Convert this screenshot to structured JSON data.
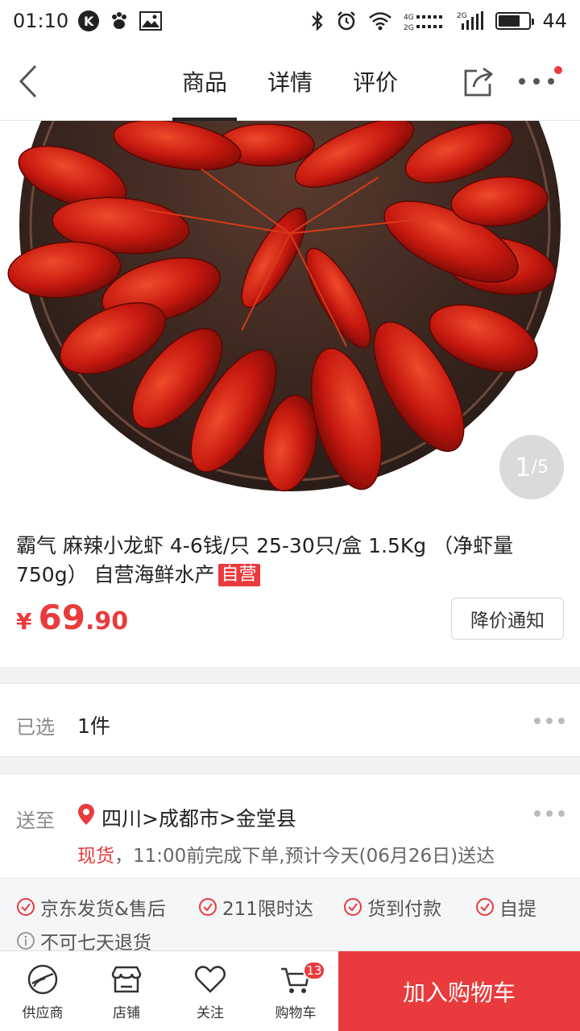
{
  "status_bar": {
    "time": "01:10",
    "k_badge": "K",
    "battery_level": "44",
    "battery_fraction": 0.7,
    "icons": [
      "k-app-icon",
      "baidu-paw-icon",
      "image-icon",
      "bluetooth-icon",
      "alarm-icon",
      "wifi-icon",
      "signal-4g-icon",
      "signal-2g-icon",
      "battery-icon"
    ]
  },
  "nav": {
    "tabs": [
      {
        "label": "商品",
        "active": true
      },
      {
        "label": "详情",
        "active": false
      },
      {
        "label": "评价",
        "active": false
      }
    ],
    "icons": [
      "back-arrow-icon",
      "share-icon",
      "more-icon"
    ]
  },
  "gallery": {
    "current": "1",
    "total": "/5"
  },
  "product": {
    "title": "霸气 麻辣小龙虾 4-6钱/只 25-30只/盒 1.5Kg （净虾量750g） 自营海鲜水产",
    "self_badge": "自营",
    "price_symbol": "¥",
    "price_int": "69",
    "price_dec": ".90",
    "notify_label": "降价通知"
  },
  "selection": {
    "label": "已选",
    "value": "1件"
  },
  "delivery": {
    "label": "送至",
    "address": "四川>成都市>金堂县",
    "stock": "现货",
    "note": "，11:00前完成下单,预计今天(06月26日)送达"
  },
  "services": [
    {
      "label": "京东发货&售后",
      "icon": "check-circle-icon"
    },
    {
      "label": "211限时达",
      "icon": "check-circle-icon"
    },
    {
      "label": "货到付款",
      "icon": "check-circle-icon"
    },
    {
      "label": "自提",
      "icon": "check-circle-icon"
    },
    {
      "label": "不可七天退货",
      "icon": "info-circle-icon"
    }
  ],
  "bottom_bar": {
    "items": [
      {
        "label": "供应商",
        "icon": "supplier-icon"
      },
      {
        "label": "店铺",
        "icon": "store-icon"
      },
      {
        "label": "关注",
        "icon": "heart-icon"
      },
      {
        "label": "购物车",
        "icon": "cart-icon"
      }
    ],
    "cart_count": "13",
    "add_to_cart": "加入购物车"
  },
  "colors": {
    "accent": "#e93b3d",
    "text": "#222222",
    "muted": "#8a8a8a"
  }
}
